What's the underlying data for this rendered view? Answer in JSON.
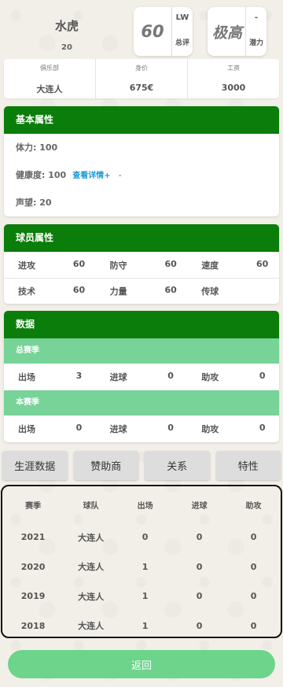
{
  "player": {
    "name": "水虎",
    "age": "20"
  },
  "overall": {
    "value": "60",
    "position": "LW",
    "label": "总评"
  },
  "potential": {
    "value": "极高",
    "dash": "-",
    "label": "潜力"
  },
  "info": [
    {
      "label": "俱乐部",
      "value": "大连人"
    },
    {
      "label": "身价",
      "value": "675€"
    },
    {
      "label": "工资",
      "value": "3000"
    }
  ],
  "basic": {
    "title": "基本属性",
    "stamina": "体力: 100",
    "health": "健康度: 100",
    "health_link": "查看详情+",
    "health_dash": "-",
    "fame": "声望: 20"
  },
  "attributes": {
    "title": "球员属性",
    "rows": [
      [
        {
          "k": "进攻",
          "v": "60"
        },
        {
          "k": "防守",
          "v": "60"
        },
        {
          "k": "速度",
          "v": "60"
        }
      ],
      [
        {
          "k": "技术",
          "v": "60"
        },
        {
          "k": "力量",
          "v": "60"
        },
        {
          "k": "传球",
          "v": ""
        }
      ]
    ]
  },
  "stats": {
    "title": "数据",
    "total_label": "总赛季",
    "total": [
      {
        "k": "出场",
        "v": "3"
      },
      {
        "k": "进球",
        "v": "0"
      },
      {
        "k": "助攻",
        "v": "0"
      }
    ],
    "season_label": "本赛季",
    "season": [
      {
        "k": "出场",
        "v": "0"
      },
      {
        "k": "进球",
        "v": "0"
      },
      {
        "k": "助攻",
        "v": "0"
      }
    ]
  },
  "tabs": [
    "生涯数据",
    "赞助商",
    "关系",
    "特性"
  ],
  "career": {
    "headers": [
      "赛季",
      "球队",
      "出场",
      "进球",
      "助攻"
    ],
    "rows": [
      [
        "2021",
        "大连人",
        "0",
        "0",
        "0"
      ],
      [
        "2020",
        "大连人",
        "1",
        "0",
        "0"
      ],
      [
        "2019",
        "大连人",
        "1",
        "0",
        "0"
      ],
      [
        "2018",
        "大连人",
        "1",
        "0",
        "0"
      ]
    ]
  },
  "back_label": "返回",
  "colors": {
    "header_green": "#0a7d0a",
    "season_green": "#77d398",
    "button_green": "#6dd48c",
    "link_blue": "#1a9ad6"
  }
}
